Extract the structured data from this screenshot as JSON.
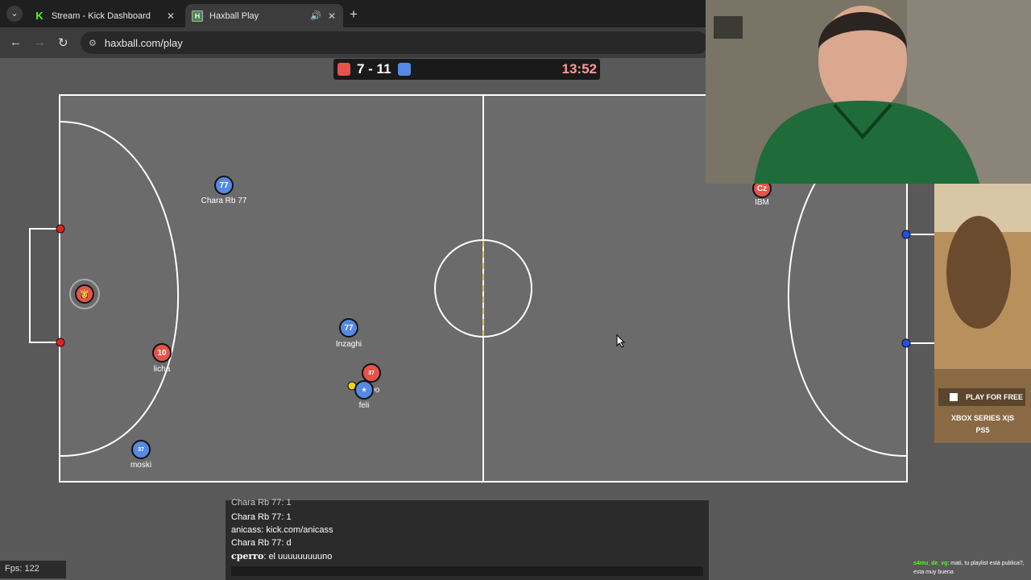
{
  "browser": {
    "tabs": [
      {
        "title": "Stream - Kick Dashboard",
        "icon": "kick-icon"
      },
      {
        "title": "Haxball Play",
        "icon": "haxball-icon",
        "active": true
      }
    ],
    "url": "haxball.com/play"
  },
  "game": {
    "score": "7 - 11",
    "timer": "13:52",
    "colors": {
      "red": "#e5534b",
      "blue": "#5689e5",
      "field": "#595959"
    },
    "players": [
      {
        "team": "blue",
        "avatar": "77",
        "name": "Chara Rb 77"
      },
      {
        "team": "red",
        "avatar": "Cz",
        "name": "IBM"
      },
      {
        "team": "red",
        "avatar": "👸",
        "name": ""
      },
      {
        "team": "blue",
        "avatar": "77",
        "name": "Inzaghi"
      },
      {
        "team": "red",
        "avatar": "10",
        "name": "licha"
      },
      {
        "team": "red",
        "avatar": "37",
        "name": "vo"
      },
      {
        "team": "blue",
        "avatar": "★",
        "name": "feli"
      },
      {
        "team": "blue",
        "avatar": "37",
        "name": "moski"
      }
    ]
  },
  "chat": {
    "lines": [
      {
        "user": "",
        "text": "Chara Rb 77: 1"
      },
      {
        "user": "",
        "text": "Chara Rb 77: 1"
      },
      {
        "user": "",
        "text": "anicass: kick.com/anicass"
      },
      {
        "user": "",
        "text": "Chara Rb 77: d"
      },
      {
        "user": "cperro",
        "text": ": el uuuuuuuuuno"
      }
    ]
  },
  "fps": "Fps: 122",
  "ad": {
    "button": "PLAY FOR FREE",
    "platform1": "XBOX SERIES X|S",
    "platform2": "PS5"
  },
  "stream_chat": {
    "user": "s4mu_de_vg",
    "message": ": mati, tu playlist está publica?, esta muy buena"
  }
}
